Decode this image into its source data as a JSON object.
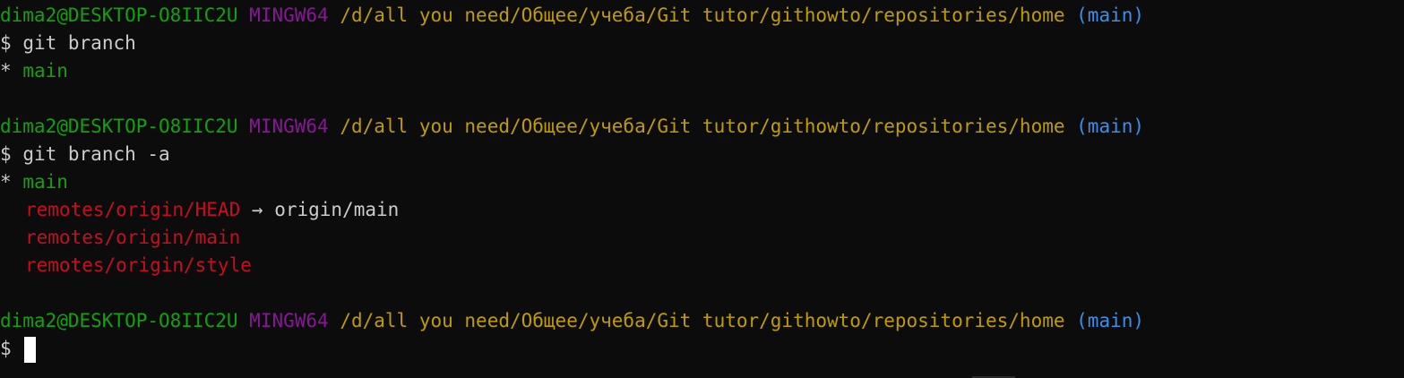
{
  "terminal": {
    "prompt": {
      "user_host": "dima2@DESKTOP-O8IIC2U",
      "system": "MINGW64",
      "path": "/d/all you need/Общее/учеба/Git tutor/githowto/repositories/home",
      "branch": "(main)",
      "symbol": "$"
    },
    "blocks": [
      {
        "command": "git branch",
        "output": [
          {
            "marker": "*",
            "name": "main"
          }
        ]
      },
      {
        "command": "git branch -a",
        "output_current": {
          "marker": "*",
          "name": "main"
        },
        "remotes": [
          {
            "name": "remotes/origin/HEAD",
            "arrow": "→",
            "target": "origin/main"
          },
          {
            "name": "remotes/origin/main"
          },
          {
            "name": "remotes/origin/style"
          }
        ]
      }
    ],
    "colors": {
      "user_host": "#13a10e",
      "system": "#881798",
      "path": "#c19c00",
      "branch": "#3b8eea",
      "current_branch": "#13a10e",
      "remote_branch": "#c50f1f",
      "text": "#cccccc",
      "background": "#0c0c0c",
      "cursor": "#ffffff"
    }
  }
}
